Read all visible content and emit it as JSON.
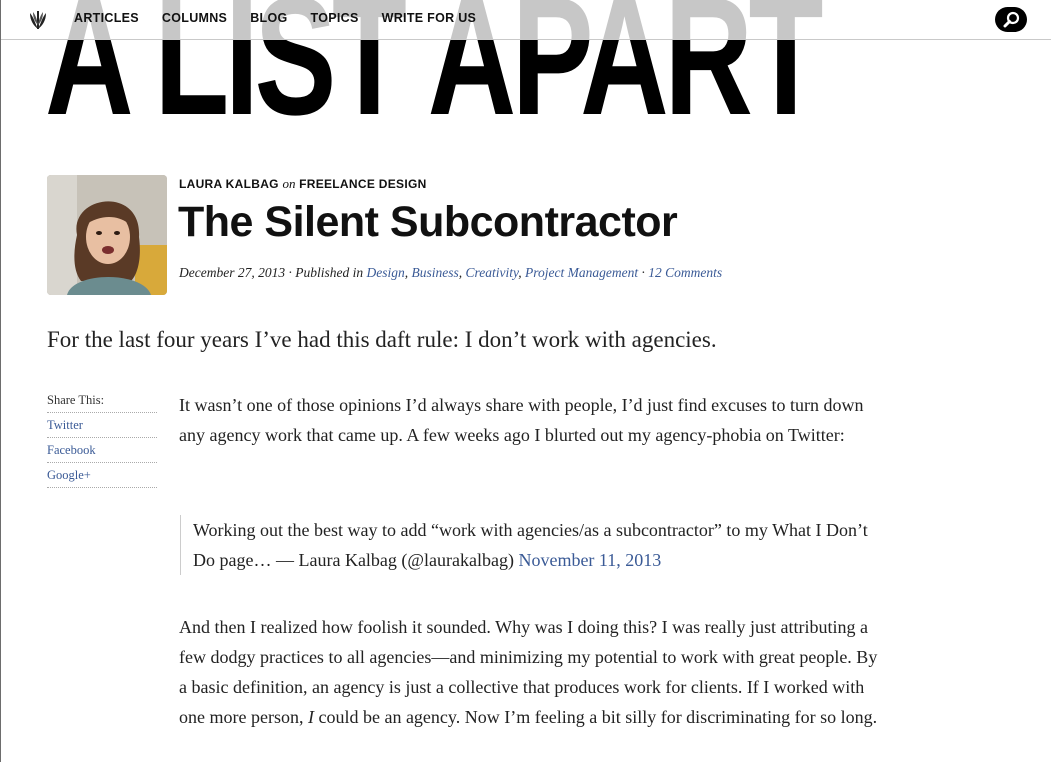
{
  "masthead": {
    "logo_text": "A LIST APART"
  },
  "nav": {
    "items": [
      "ARTICLES",
      "COLUMNS",
      "BLOG",
      "TOPICS",
      "WRITE FOR US"
    ]
  },
  "article": {
    "author": "LAURA KALBAG",
    "on_word": "on",
    "section": "FREELANCE DESIGN",
    "title": "The Silent Subcontractor",
    "date": "December 27, 2013",
    "published_in_label": "· Published in",
    "categories": [
      "Design",
      "Business",
      "Creativity",
      "Project Management"
    ],
    "comments": "12 Comments",
    "lede": "For the last four years I’ve had this daft rule: I don’t work with agencies.",
    "paragraph1": "It wasn’t one of those opinions I’d always share with people, I’d just find excuses to turn down any agency work that came up. A few weeks ago I blurted out my agency-phobia on Twitter:",
    "quote_text": "Working out the best way to add “work with agencies/as a subcontractor” to my What I Don’t Do page… — Laura Kalbag (@laurakalbag)",
    "quote_link": "November 11, 2013",
    "paragraph2_part1": "And then I realized how foolish it sounded. Why was I doing this? I was really just attributing a few dodgy practices to all agencies—and minimizing my potential to work with great people. By a basic definition, an agency is just a collective that produces work for clients. If I worked with one more person,",
    "paragraph2_emph": "I",
    "paragraph2_part2": "could be an agency. Now I’m feeling a bit silly for discriminating for so long."
  },
  "share": {
    "label": "Share This:",
    "links": [
      "Twitter",
      "Facebook",
      "Google+"
    ]
  },
  "icons": {
    "site_logo": "laurel-icon",
    "search": "search-icon"
  },
  "colors": {
    "link": "#3a5a96",
    "text": "#222222",
    "masthead": "#000000"
  }
}
